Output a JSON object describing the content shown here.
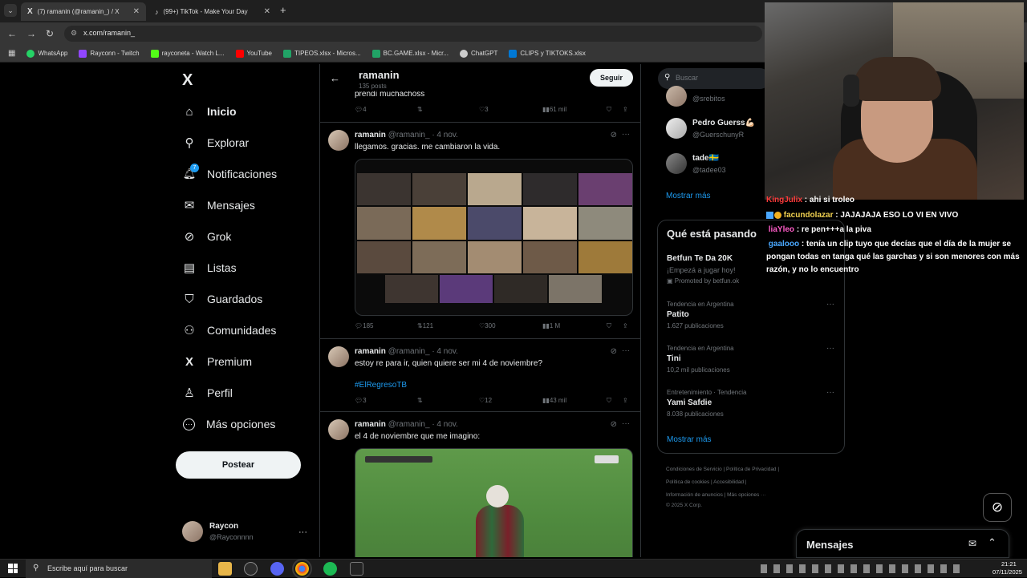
{
  "browser": {
    "tabs": [
      {
        "label": "(7) ramanin (@ramanin_) / X",
        "active": true
      },
      {
        "label": "(99+) TikTok - Make Your Day",
        "active": false
      }
    ],
    "new_tab": "+",
    "url": "x.com/ramanin_",
    "bookmarks": [
      {
        "label": "WhatsApp",
        "color": "#25d366"
      },
      {
        "label": "Rayconn - Twitch",
        "color": "#9146ff"
      },
      {
        "label": "rayconeta - Watch L...",
        "color": "#53fc18"
      },
      {
        "label": "YouTube",
        "color": "#ff0000"
      },
      {
        "label": "TIPEOS.xlsx - Micros...",
        "color": "#21a366"
      },
      {
        "label": "BC.GAME.xlsx - Micr...",
        "color": "#21a366"
      },
      {
        "label": "ChatGPT",
        "color": "#cccccc"
      },
      {
        "label": "CLIPS y TIKTOKS.xlsx",
        "color": "#0078d4"
      }
    ]
  },
  "nav": {
    "logo": "X",
    "items": [
      {
        "label": "Inicio",
        "icon": "home-icon",
        "glyph": "⌂"
      },
      {
        "label": "Explorar",
        "icon": "search-icon",
        "glyph": "⚲"
      },
      {
        "label": "Notificaciones",
        "icon": "bell-icon",
        "glyph": "🔔︎",
        "badge": "7"
      },
      {
        "label": "Mensajes",
        "icon": "mail-icon",
        "glyph": "✉"
      },
      {
        "label": "Grok",
        "icon": "grok-icon",
        "glyph": "⊘"
      },
      {
        "label": "Listas",
        "icon": "list-icon",
        "glyph": "▤"
      },
      {
        "label": "Guardados",
        "icon": "bookmark-icon",
        "glyph": "⛉"
      },
      {
        "label": "Comunidades",
        "icon": "communities-icon",
        "glyph": "⚇"
      },
      {
        "label": "Premium",
        "icon": "x-premium-icon",
        "glyph": "X"
      },
      {
        "label": "Perfil",
        "icon": "person-icon",
        "glyph": "♙"
      },
      {
        "label": "Más opciones",
        "icon": "more-circle-icon",
        "glyph": "⋯"
      }
    ],
    "post_button": "Postear",
    "account": {
      "name": "Raycon",
      "handle": "@Rayconnnn",
      "more": "···"
    }
  },
  "profile_header": {
    "name": "ramanin",
    "posts": "135 posts",
    "follow": "Seguir",
    "back": "←"
  },
  "tweets": [
    {
      "partial_text": "prendí muchachoss",
      "replies": "4",
      "reposts": "",
      "likes": "3",
      "views": "61 mil"
    },
    {
      "name": "ramanin",
      "handle": "@ramanin_",
      "date": "· 4 nov.",
      "text": "llegamos. gracias. me cambiaron la vida.",
      "replies": "185",
      "reposts": "121",
      "likes": "300",
      "views": "1 M"
    },
    {
      "name": "ramanin",
      "handle": "@ramanin_",
      "date": "· 4 nov.",
      "text": "estoy re para ir, quien quiere ser mi 4 de noviembre?",
      "hashtag": "#ElRegresoTB",
      "replies": "3",
      "reposts": "",
      "likes": "12",
      "views": "43 mil"
    },
    {
      "name": "ramanin",
      "handle": "@ramanin_",
      "date": "· 4 nov.",
      "text": "el 4 de noviembre que me imagino:"
    }
  ],
  "search": {
    "placeholder": "Buscar"
  },
  "who_to_follow": [
    {
      "name": "",
      "handle": "@srebitos"
    },
    {
      "name": "Pedro Guerss💪🏻",
      "handle": "@GuerschunyR"
    },
    {
      "name": "tade🇸🇪",
      "handle": "@tadee03"
    }
  ],
  "show_more_1": "Mostrar más",
  "trends": {
    "title": "Qué está pasando",
    "promo": {
      "name": "Betfun Te Da 20K",
      "sub": "¡Empezá a jugar hoy!",
      "promoted": "Promoted by betfun.ok"
    },
    "items": [
      {
        "category": "Tendencia en Argentina",
        "name": "Patito",
        "count": "1.627 publicaciones"
      },
      {
        "category": "Tendencia en Argentina",
        "name": "Tini",
        "count": "10,2 mil publicaciones"
      },
      {
        "category": "Entretenimiento · Tendencia",
        "name": "Yami Safdie",
        "count": "8.038 publicaciones"
      }
    ],
    "show_more": "Mostrar más",
    "more": "···"
  },
  "footer": [
    "Condiciones de Servicio",
    "Política de Privacidad",
    "Política de cookies",
    "Accesibilidad",
    "Información de anuncios",
    "Más opciones ···",
    "© 2025 X Corp."
  ],
  "chat": [
    {
      "user": "KingJulix",
      "msg": ": ahi si troleo",
      "color": "#ff3b3b"
    },
    {
      "user": "facundolazar",
      "msg": ": JAJAJAJA ESO LO VI EN VIVO",
      "color": "#f0d050"
    },
    {
      "user": "liaYleo",
      "msg": ": re pen+++a la piva",
      "color": "#ff5cc8"
    },
    {
      "user": "gaalooo",
      "msg": ": tenía un clip tuyo que decías que el día de la mujer se pongan todas en tanga qué las garchas y si son menores con más razón, y no lo encuentro",
      "color": "#4aa8ff"
    }
  ],
  "messages_drawer": {
    "title": "Mensajes"
  },
  "taskbar": {
    "search_placeholder": "Escribe aquí para buscar",
    "time": "21:21",
    "date": "07/11/2025"
  }
}
